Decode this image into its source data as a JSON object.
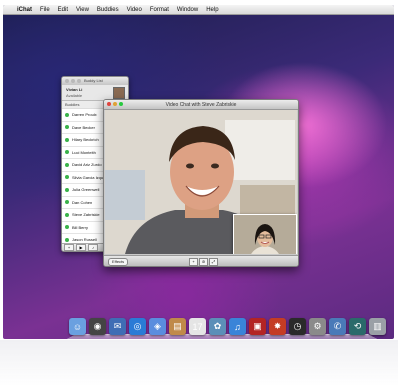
{
  "menubar": {
    "apple": "",
    "items": [
      "iChat",
      "File",
      "Edit",
      "View",
      "Buddies",
      "Video",
      "Format",
      "Window",
      "Help"
    ]
  },
  "buddy_list": {
    "title": "Buddy List",
    "me_name": "Vivian Li",
    "me_status": "Available",
    "group": "Buddies",
    "buddies": [
      "Darren Proulx",
      "Dave Becker",
      "Hilary Beckrich",
      "Luci Monteith",
      "David Ariz Zurdo",
      "Silvia Garcia Izquierdo",
      "Julia Greenwell",
      "Dan Cohen",
      "Steve Zabriskie",
      "Bill Berry",
      "Jason Russell",
      "Dimitri Prawne"
    ],
    "add_label": "+",
    "video_label": "▶",
    "audio_label": "♪"
  },
  "video_window": {
    "title": "Video Chat with Steve Zabriskie",
    "effects_label": "Effects",
    "add_label": "+",
    "mute_label": "⊘",
    "fullscreen_label": "⤢"
  },
  "dock_icons": [
    "finder-icon",
    "dashboard-icon",
    "mail-stamp-icon",
    "safari-icon",
    "facetime-icon",
    "address-book-icon",
    "ical-icon",
    "iphoto-icon",
    "itunes-icon",
    "dvd-icon",
    "photobooth-icon",
    "timemachine-icon",
    "preferences-icon",
    "ichat-icon",
    "system-icon",
    "trash-icon"
  ],
  "colors": {
    "online": "#3ab34a",
    "close": "#e0443e",
    "minimize": "#dea236",
    "zoom": "#28c940"
  }
}
